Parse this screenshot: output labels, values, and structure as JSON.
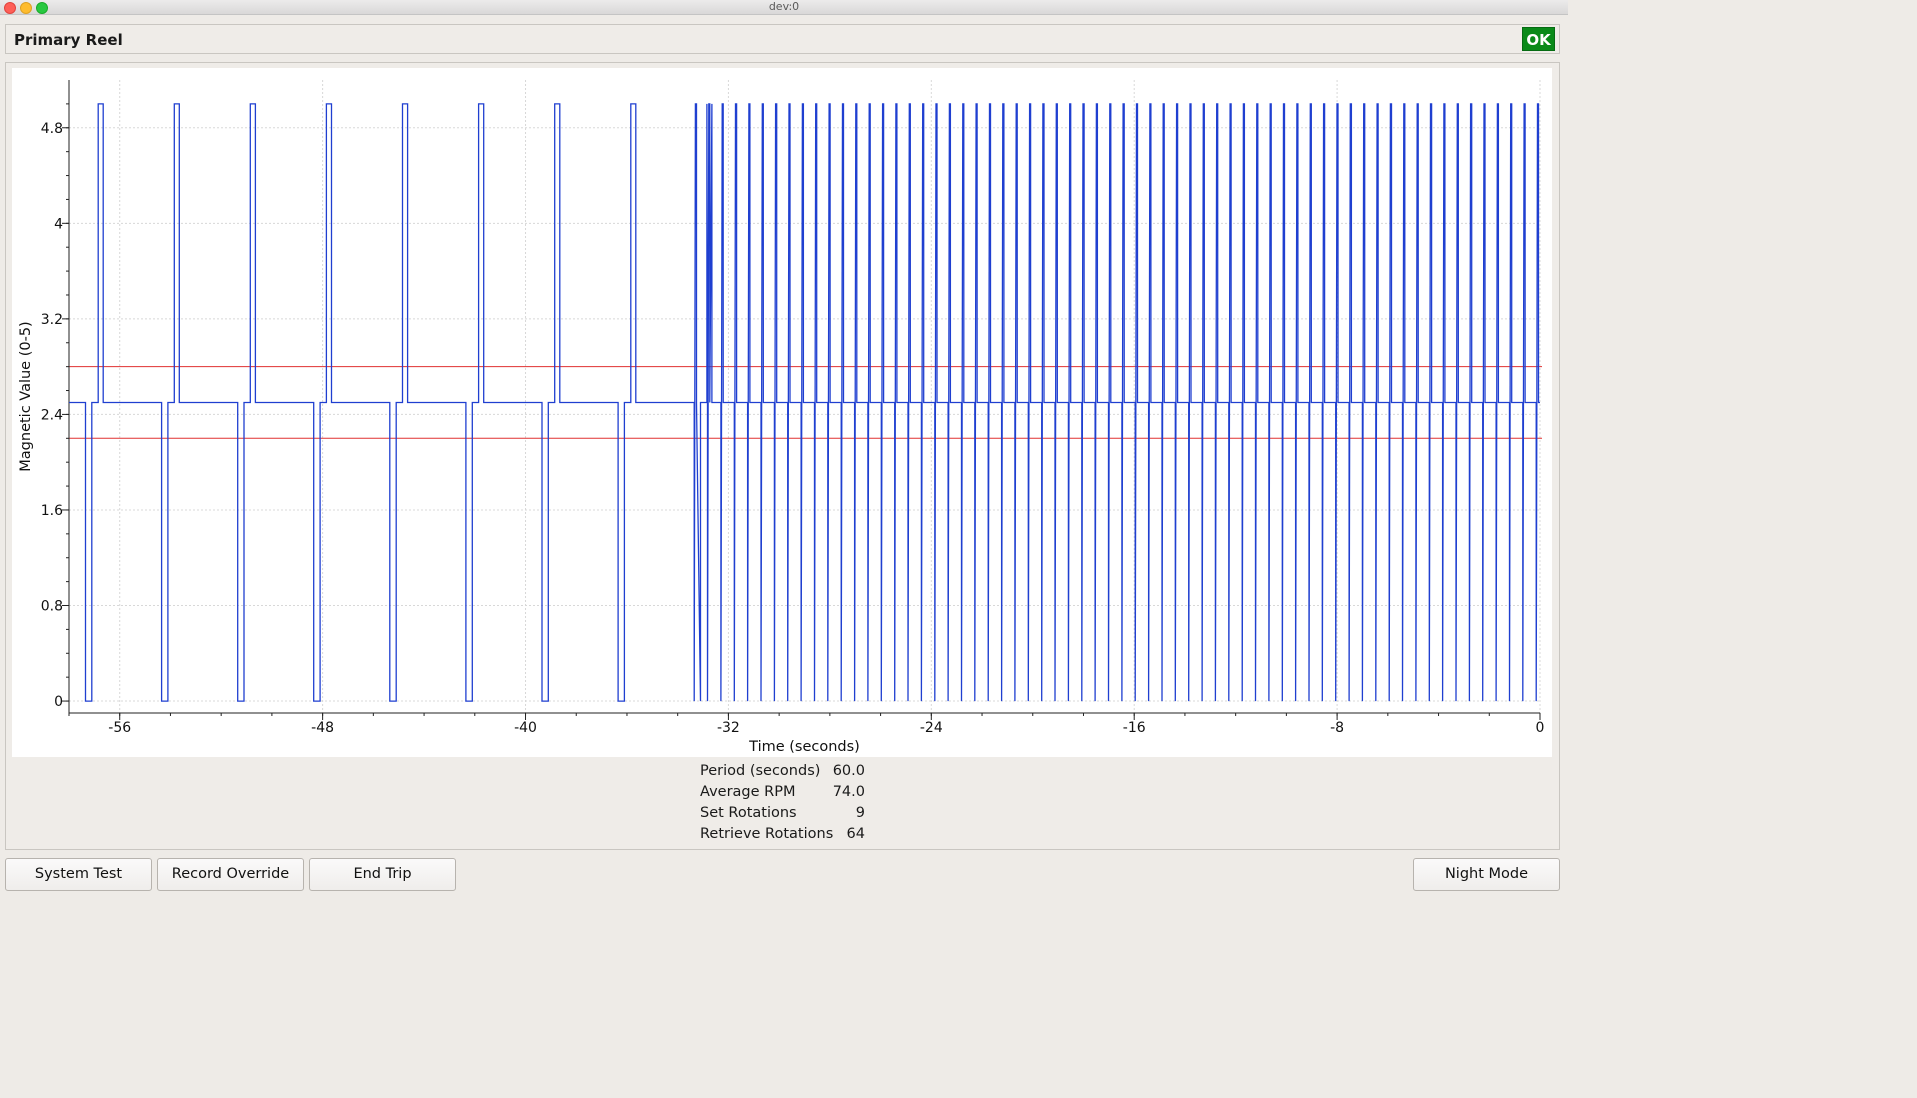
{
  "window": {
    "title": "dev:0"
  },
  "header": {
    "title": "Primary Reel",
    "status": "OK",
    "status_color": "#0a8a19"
  },
  "chart_data": {
    "type": "line",
    "xlabel": "Time (seconds)",
    "ylabel": "Magnetic Value (0-5)",
    "xlim": [
      -58,
      0
    ],
    "ylim": [
      -0.1,
      5.2
    ],
    "x_ticks": [
      -56,
      -48,
      -40,
      -32,
      -24,
      -16,
      -8,
      0
    ],
    "y_ticks": [
      0,
      0.8,
      1.6,
      2.4,
      3.2,
      4.0,
      4.8
    ],
    "y_tick_labels": [
      "0",
      "0.8",
      "1.6",
      "2.4",
      "3.2",
      "4",
      "4.8"
    ],
    "grid": true,
    "threshold_lines": [
      2.8,
      2.2
    ],
    "threshold_color": "#e03030",
    "series_color": "#1f3fd0",
    "baseline": 2.5,
    "pulse_low": 0.0,
    "pulse_high": 5.0,
    "series": [
      {
        "slow_pulse_times": [
          -57.0,
          -54.0,
          -51.0,
          -48.0,
          -45.0,
          -42.0,
          -39.0,
          -36.0,
          -33.0
        ],
        "fast_pulse_start": -33.3,
        "fast_pulse_end": -0.1,
        "fast_pulse_count": 64
      }
    ]
  },
  "stats": {
    "rows": [
      {
        "label": "Period (seconds)",
        "value": "60.0"
      },
      {
        "label": "Average RPM",
        "value": "74.0"
      },
      {
        "label": "Set Rotations",
        "value": "9"
      },
      {
        "label": "Retrieve Rotations",
        "value": "64"
      }
    ]
  },
  "buttons": {
    "system_test": "System Test",
    "record_override": "Record Override",
    "end_trip": "End Trip",
    "night_mode": "Night Mode"
  }
}
